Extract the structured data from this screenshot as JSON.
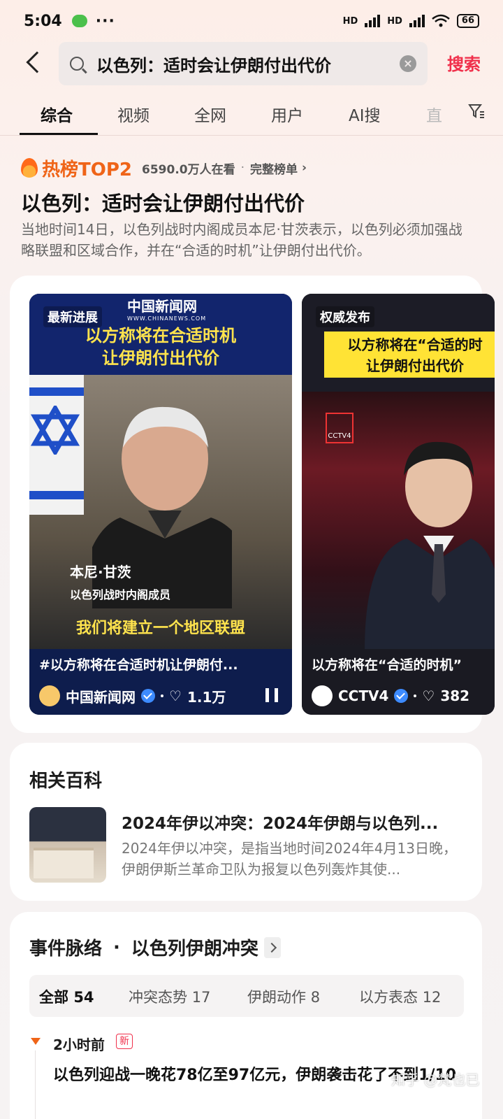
{
  "status": {
    "time": "5:04",
    "more": "···",
    "battery": "66",
    "hd1": "HD",
    "hd2": "HD"
  },
  "search": {
    "query": "以色列：适时会让伊朗付出代价",
    "button": "搜索"
  },
  "tabs": [
    "综合",
    "视频",
    "全网",
    "用户",
    "AI搜",
    "直"
  ],
  "hot": {
    "label": "热榜TOP2",
    "viewers": "6590.0万人在看",
    "sep": "·",
    "full_list": "完整榜单"
  },
  "headline": "以色列：适时会让伊朗付出代价",
  "summary": "当地时间14日，以色列战时内阁成员本尼·甘茨表示，以色列必须加强战略联盟和区域合作，并在“合适的时机”让伊朗付出代价。",
  "videos": [
    {
      "tag": "最新进展",
      "logo": "中国新闻网",
      "logo_sub": "WWW.CHINANEWS.COM",
      "banner_title": "以方称将在合适时机\n让伊朗付出代价",
      "name": "本尼·甘茨",
      "role": "以色列战时内阁成员",
      "quote": "我们将建立一个地区联盟",
      "caption": "#以方称将在合适时机让伊朗付...",
      "source": "中国新闻网",
      "likes": "1.1万"
    },
    {
      "tag": "权威发布",
      "banner_title": "以方称将在“合适的时\n让伊朗付出代价",
      "channel": "CCTV4",
      "caption": "以方称将在“合适的时机”",
      "source": "CCTV4",
      "likes": "382"
    }
  ],
  "wiki": {
    "section_title": "相关百科",
    "title": "2024年伊以冲突：2024年伊朗与以色列...",
    "desc": "2024年伊以冲突，是指当地时间2024年4月13日晚，伊朗伊斯兰革命卫队为报复以色列轰炸其使..."
  },
  "events": {
    "title": "事件脉络",
    "dot": "·",
    "topic": "以色列伊朗冲突",
    "filters": [
      {
        "label": "全部",
        "count": "54"
      },
      {
        "label": "冲突态势",
        "count": "17"
      },
      {
        "label": "伊朗动作",
        "count": "8"
      },
      {
        "label": "以方表态",
        "count": "12"
      }
    ],
    "item": {
      "time": "2小时前",
      "badge": "新",
      "text": "以色列迎战一晚花78亿至97亿元，伊朗袭击花了不到1/10"
    }
  },
  "watermark": "知乎 @梵也已",
  "colors": {
    "accent": "#f0304b",
    "hot": "#ef6418",
    "banner_yellow": "#ffe34d",
    "verified": "#3d8bff"
  }
}
